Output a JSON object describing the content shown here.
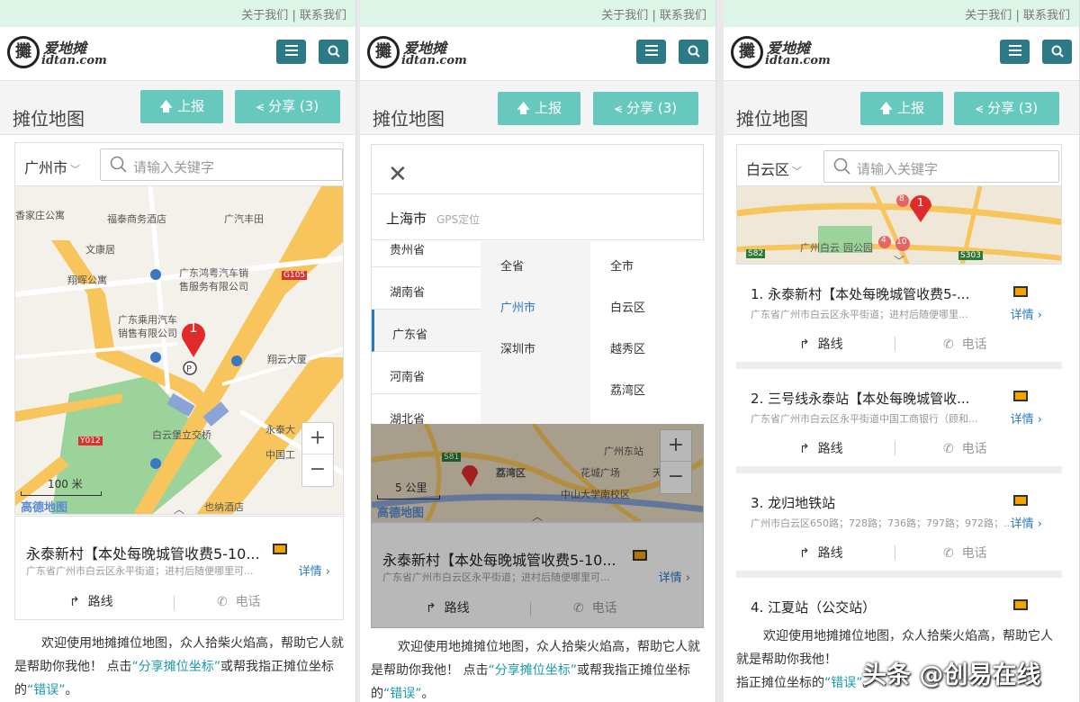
{
  "topnav": {
    "about": "关于我们",
    "sep": "|",
    "contact": "联系我们"
  },
  "logo": {
    "seal": "攤",
    "cn": "爱地摊",
    "en": "idtan.com"
  },
  "page_title": "摊位地图",
  "buttons": {
    "report": "上报",
    "share": "分享 (3)"
  },
  "search": {
    "placeholder": "请输入关键字"
  },
  "panel1": {
    "city": "广州市",
    "map_labels": [
      "香家庄公寓",
      "福泰商务酒店",
      "广汽丰田",
      "文康居",
      "翔晖公寓",
      "广东鸿粤汽车销",
      "售服务有限公司",
      "G105",
      "广东乘用汽车",
      "销售有限公司",
      "翔云大厦",
      "白云堡立交桥",
      "永泰大",
      "中国工",
      "Y012",
      "也纳酒店"
    ],
    "pin_number": "1",
    "scale": "100 米",
    "map_brand": "高德地图"
  },
  "panel2": {
    "current_city": "上海市",
    "gps": "GPS定位",
    "provinces": [
      "贵州省",
      "湖南省",
      "广东省",
      "河南省",
      "湖北省"
    ],
    "selected_province": "广东省",
    "cities": [
      "全省",
      "广州市",
      "深圳市"
    ],
    "selected_city": "广州市",
    "districts": [
      "全市",
      "白云区",
      "越秀区",
      "荔湾区"
    ],
    "map_labels": [
      "S81",
      "荔湾区",
      "花城广场",
      "广州东站",
      "中山大学南校区",
      "天"
    ],
    "scale": "5 公里",
    "map_brand": "高德地图"
  },
  "panel3": {
    "city": "白云区",
    "map_labels": [
      "广州白云",
      "园公园",
      "S82",
      "S303",
      "8",
      "4",
      "10",
      "1"
    ],
    "items": [
      {
        "name": "1. 永泰新村【本处每晚城管收费5-...",
        "addr": "广东省广州市白云区永平街道；进村后随便哪里..."
      },
      {
        "name": "2. 三号线永泰站【本处每晚城管收...",
        "addr": "广东省广州市白云区永平街道中国工商银行（顾和..."
      },
      {
        "name": "3. 龙归地铁站",
        "addr": "广州市白云区650路；728路；736路；797路；972路；..."
      },
      {
        "name": "4. 江夏站（公交站）",
        "addr": ""
      }
    ]
  },
  "card": {
    "title": "永泰新村【本处每晚城管收费5-10...",
    "address": "广东省广州市白云区永平街道；进村后随便哪里可...",
    "detail": "详情",
    "route": "路线",
    "phone": "电话"
  },
  "intro": {
    "part1": "欢迎使用地摊摊位地图，众人拾柴火焰高，帮助它人就是帮助你我他！ 点击",
    "link1": "“分享摊位坐标”",
    "part2": "或帮我指正摊位坐标的",
    "link2": "“错误”",
    "part3": "。",
    "p3_part1": "欢迎使用地摊摊位地图，众人拾柴火焰高，帮助它人就是帮助你我他！",
    "p3_part2": "指正摊位坐标的",
    "p3_link": "“错误”",
    "p3_part3": "。"
  },
  "watermark": "头条 @创易在线",
  "colors": {
    "teal_button": "#67c8bd",
    "dark_teal": "#2c7a86",
    "link_blue": "#2a7ac0",
    "topbar_green": "#ddf5e6",
    "pin_red": "#e02b2b"
  }
}
